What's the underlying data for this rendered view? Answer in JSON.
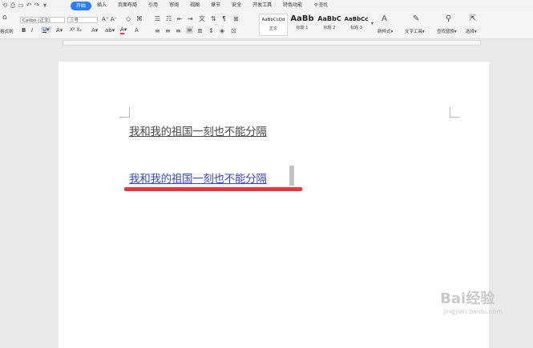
{
  "menu": {
    "tabs": [
      "开始",
      "插入",
      "页面布局",
      "引用",
      "审阅",
      "视图",
      "章节",
      "安全",
      "开发工具",
      "特色功能"
    ],
    "active_tab": "开始",
    "search_label": "查找",
    "accent_color": "#2f7df6"
  },
  "ribbon": {
    "format_painter": "格式刷",
    "font_name": "Calibri (正文)",
    "font_size": "三号",
    "styles": [
      {
        "sample": "AaBbCcDd",
        "name": "正文"
      },
      {
        "sample": "AaBb",
        "name": "标题 1"
      },
      {
        "sample": "AaBbC",
        "name": "标题 2"
      },
      {
        "sample": "AaBbCc",
        "name": "标题 3"
      }
    ],
    "new_style": "新样式",
    "text_tools": "文字工具",
    "find_replace": "查找替换",
    "select": "选择"
  },
  "document": {
    "line1": "我和我的祖国一刻也不能分隔",
    "line2": "我和我的祖国一刻也不能分隔",
    "line2_color": "#3c49b8",
    "highlight_color": "#e83640"
  },
  "watermark": {
    "brand": "Bai经验",
    "url": "jingyan.baidu.com"
  }
}
